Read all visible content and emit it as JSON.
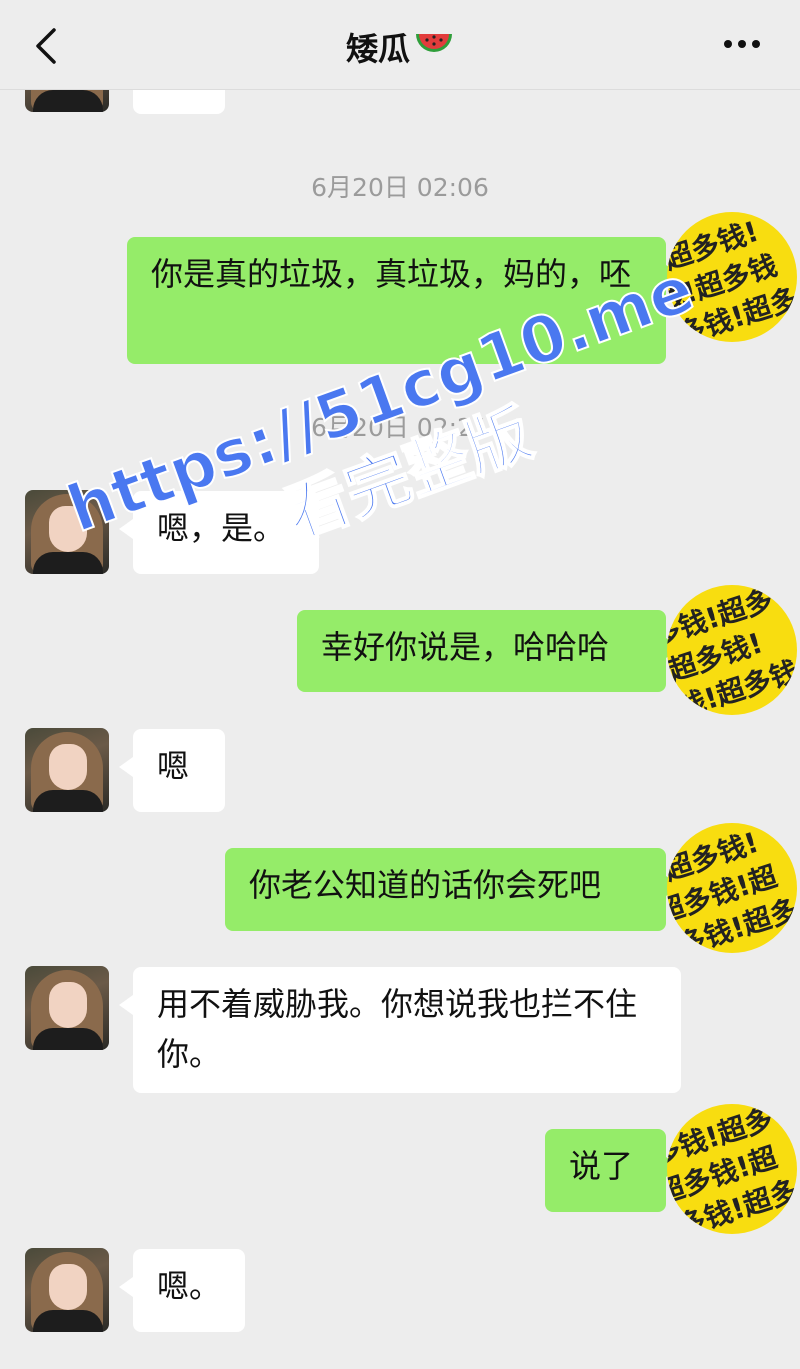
{
  "header": {
    "back_icon": "chevron-left-icon",
    "title": "矮瓜",
    "title_emoji": "watermelon-icon",
    "more_icon": "more-dots-icon"
  },
  "self_avatar_text": "超多钱!超多钱!超多钱!",
  "timestamps": [
    "6月20日 02:06",
    "6月20日 02:21"
  ],
  "messages": [
    {
      "side": "right",
      "text": "你是真的垃圾，真垃圾，妈的，呸"
    },
    {
      "side": "left",
      "text": "嗯，是。"
    },
    {
      "side": "right",
      "text": "幸好你说是，哈哈哈"
    },
    {
      "side": "left",
      "text": "嗯"
    },
    {
      "side": "right",
      "text": "你老公知道的话你会死吧"
    },
    {
      "side": "left",
      "text": "用不着威胁我。你想说我也拦不住你。"
    },
    {
      "side": "right",
      "text": "说了"
    },
    {
      "side": "left",
      "text": "嗯。"
    }
  ],
  "watermark": {
    "url": "https://51cg10.me",
    "subtitle": "看完整版"
  },
  "colors": {
    "background": "#ededed",
    "self_bubble": "#95ec69",
    "other_bubble": "#ffffff",
    "timestamp": "#9b9b9b",
    "watermark": "#4a78f0"
  }
}
